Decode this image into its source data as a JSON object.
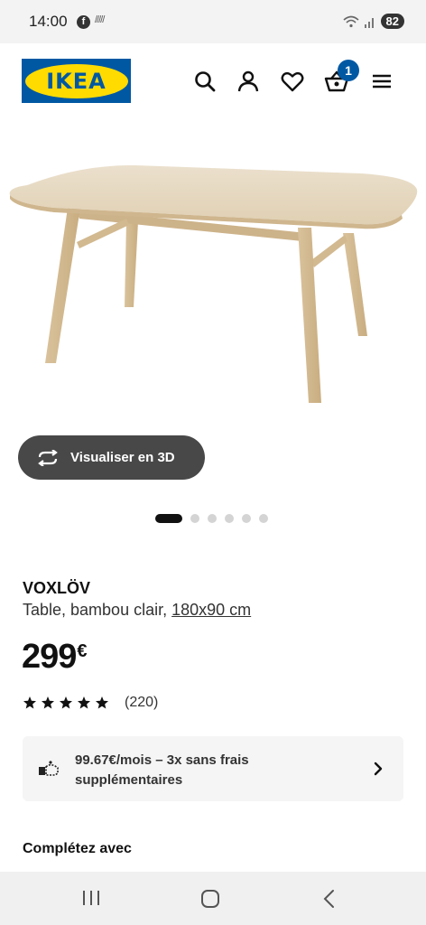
{
  "status_bar": {
    "time": "14:00",
    "fb_letter": "f",
    "small_signal": "/////",
    "battery": "82"
  },
  "header": {
    "logo_text": "IKEA",
    "cart_count": "1",
    "icons": [
      "search-icon",
      "account-icon",
      "heart-icon",
      "basket-icon",
      "menu-icon"
    ]
  },
  "product": {
    "image_icon": "dining-table-image",
    "visualize_label": "Visualiser en 3D",
    "name": "VOXLÖV",
    "description": "Table, bambou clair,",
    "dimensions": "180x90 cm",
    "price": "299",
    "currency": "€",
    "rating_stars": 5,
    "rating_count": "(220)",
    "carousel_total": 6,
    "carousel_active": 1
  },
  "finance": {
    "line1": "99.67€/mois – 3x sans frais",
    "line2": "supplémentaires"
  },
  "section": {
    "complete_title": "Complétez avec"
  },
  "colors": {
    "ikea_blue": "#0058a3",
    "ikea_yellow": "#ffdb00",
    "button_dark": "#484848"
  }
}
